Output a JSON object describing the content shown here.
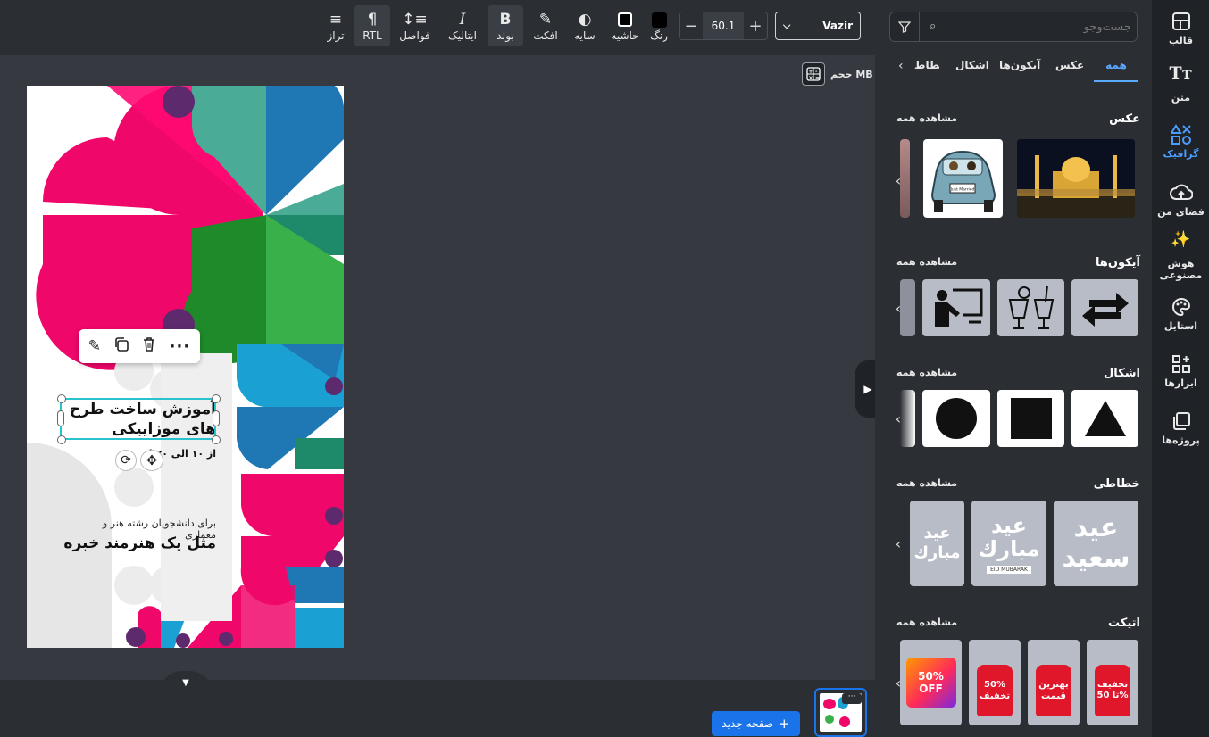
{
  "toolbar": {
    "items": [
      {
        "label": "تراز"
      },
      {
        "label": "RTL"
      },
      {
        "label": "فواصل"
      },
      {
        "label": "ایتالیک"
      },
      {
        "label": "بولد"
      },
      {
        "label": "افکت"
      },
      {
        "label": "سایه"
      },
      {
        "label": "حاشیه"
      },
      {
        "label": "رنگ"
      }
    ],
    "font_size": "60.1",
    "font_name": "Vazir"
  },
  "canvas": {
    "size_label": "حجم MB",
    "title_text": "آموزش ساخت طرح های موزاییکی",
    "date_text": "از ۱۰ الی ۲۰ ا",
    "sub_text": "برای دانشجویان رشته هنر و معماری",
    "tagline": "مثل یک هنرمند خبره"
  },
  "bottom": {
    "new_page_label": "صفحه جدید"
  },
  "panel": {
    "search_placeholder": "جست‌وجو",
    "tabs": [
      "همه",
      "عکس",
      "آیکون‌ها",
      "اشکال",
      "خطاط"
    ],
    "see_all": "مشاهده همه",
    "sections": [
      {
        "title": "عکس"
      },
      {
        "title": "آیکون‌ها"
      },
      {
        "title": "اشکال"
      },
      {
        "title": "خطاطی"
      },
      {
        "title": "اتیکت"
      }
    ],
    "license_plate": "Just Married",
    "callig_eid_saeed": "عيد سعيد",
    "callig_eid_mubarak": "عيد مبارك",
    "eid_mubarak_en": "EID MUBARAK",
    "tag_labels": [
      "تخفیف تا 50%",
      "بهترین قیمت",
      "50% تخفیف",
      "50% OFF"
    ]
  },
  "sidebar": {
    "items": [
      {
        "label": "قالب"
      },
      {
        "label": "متن"
      },
      {
        "label": "گرافیک"
      },
      {
        "label": "فضای من"
      },
      {
        "label": "هوش مصنوعی"
      },
      {
        "label": "استایل"
      },
      {
        "label": "ابزارها"
      },
      {
        "label": "پروژه‌ها"
      }
    ]
  },
  "colors": {
    "accent": "#1a73e8",
    "active_tab": "#5aa9ff",
    "pink": "#f0076a",
    "teal": "#4aab97",
    "blue": "#1f78b4",
    "green": "#3ab04a",
    "purple": "#5e2a6e"
  }
}
